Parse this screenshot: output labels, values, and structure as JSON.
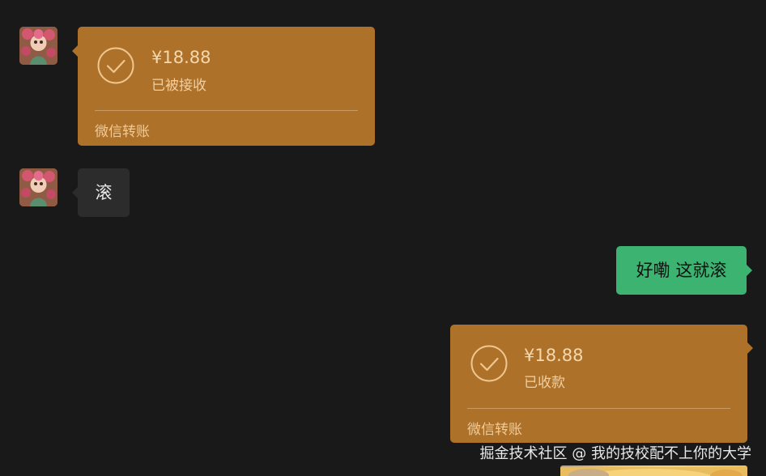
{
  "colors": {
    "background": "#191919",
    "transfer_card": "#ae7129",
    "received_bubble": "#2c2c2c",
    "sent_bubble": "#3cb371"
  },
  "messages": [
    {
      "sender": "other",
      "kind": "transfer",
      "amount": "¥18.88",
      "status": "已被接收",
      "service": "微信转账",
      "icon": "check-circle-icon"
    },
    {
      "sender": "other",
      "kind": "text",
      "text": "滚"
    },
    {
      "sender": "self",
      "kind": "text",
      "text": "好嘞 这就滚"
    },
    {
      "sender": "self",
      "kind": "transfer",
      "amount": "¥18.88",
      "status": "已收款",
      "service": "微信转账",
      "icon": "check-circle-icon"
    }
  ],
  "watermark": "掘金技术社区 @ 我的技校配不上你的大学"
}
